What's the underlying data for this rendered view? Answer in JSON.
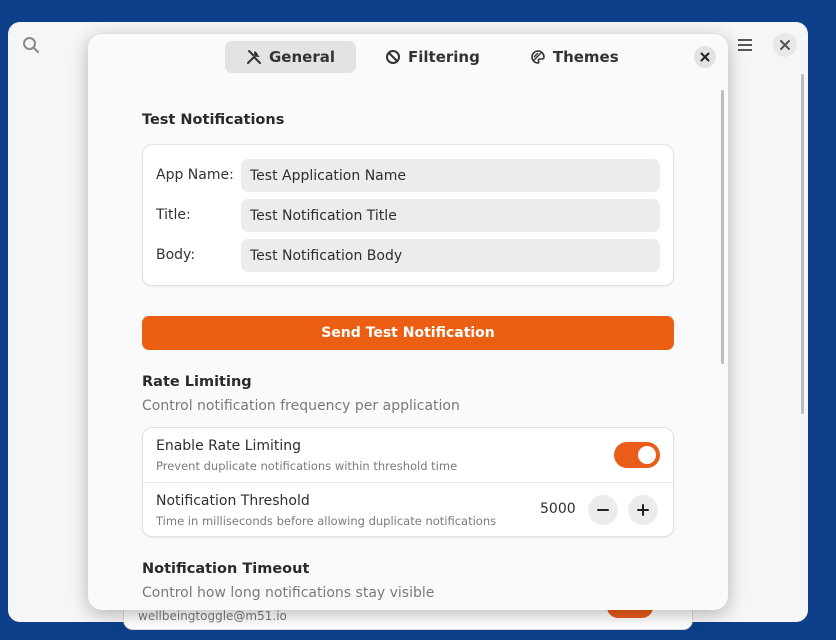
{
  "background": {
    "card_subtitle": "wellbeingtoggle@m51.io"
  },
  "tabs": [
    {
      "label": "General",
      "icon": "tools-icon",
      "active": true
    },
    {
      "label": "Filtering",
      "icon": "block-icon",
      "active": false
    },
    {
      "label": "Themes",
      "icon": "palette-icon",
      "active": false
    }
  ],
  "test_notifications": {
    "title": "Test Notifications",
    "fields": [
      {
        "label": "App Name:",
        "value": "Test Application Name"
      },
      {
        "label": "Title:",
        "value": "Test Notification Title"
      },
      {
        "label": "Body:",
        "value": "Test Notification Body"
      }
    ],
    "send_label": "Send Test Notification"
  },
  "rate_limiting": {
    "title": "Rate Limiting",
    "subtitle": "Control notification frequency per application",
    "enable": {
      "title": "Enable Rate Limiting",
      "subtitle": "Prevent duplicate notifications within threshold time",
      "on": true
    },
    "threshold": {
      "title": "Notification Threshold",
      "subtitle": "Time in milliseconds before allowing duplicate notifications",
      "value": "5000"
    }
  },
  "timeout": {
    "title": "Notification Timeout",
    "subtitle": "Control how long notifications stay visible"
  },
  "colors": {
    "accent": "#ec5e12",
    "desktop": "#0d3f8a"
  }
}
